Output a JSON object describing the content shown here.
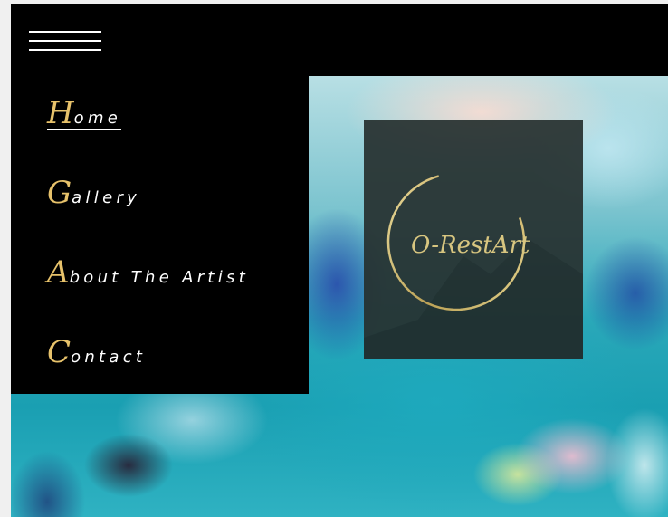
{
  "site": {
    "brand_text": "O-RestArt",
    "accent_color": "#e7c26b"
  },
  "header": {
    "menu_icon": "hamburger-menu-icon"
  },
  "menu": {
    "items": [
      {
        "initial": "H",
        "rest": "ome",
        "active": true
      },
      {
        "initial": "G",
        "rest": "allery",
        "active": false
      },
      {
        "initial": "A",
        "rest": "bout The Artist",
        "active": false
      },
      {
        "initial": "C",
        "rest": "ontact",
        "active": false
      }
    ]
  }
}
